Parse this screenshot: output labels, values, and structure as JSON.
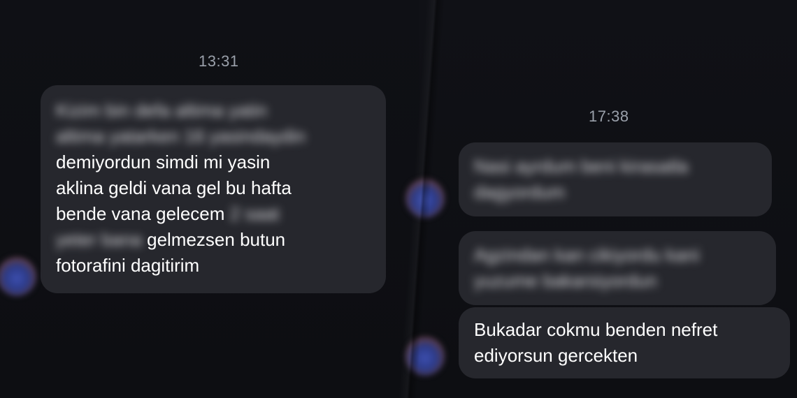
{
  "left_conversation": {
    "timestamp": "13:31",
    "message": {
      "blurred_line_1": "Kizim bin defa altima yatin",
      "blurred_line_2": "altima yatarken 16 yasindaydin",
      "line_3": "demiyordun simdi mi yasin",
      "line_4": "aklina geldi vana gel bu hafta",
      "line_5_visible": "bende vana gelecem",
      "line_5_blurred": "2 saat",
      "line_6_blurred": "yeter bana",
      "line_6_visible": "gelmezsen butun",
      "line_7": "fotorafini dagitirim"
    },
    "avatar_icon": "profile-avatar-icon"
  },
  "right_conversation": {
    "timestamp": "17:38",
    "messages": [
      {
        "blurred_line_1": "Nasi ayrdum beni kirasatla",
        "blurred_line_2": "dagyordum"
      },
      {
        "blurred_line_1": "Agzindan kan cikiyordu kani",
        "blurred_line_2": "yuzume bakarsiyordun"
      },
      {
        "line_1": "Bukadar cokmu benden nefret",
        "line_2": "ediyorsun gercekten"
      }
    ],
    "avatar_icon": "profile-avatar-icon"
  },
  "colors": {
    "background": "#0e0f14",
    "bubble": "#26272d",
    "timestamp": "#9aa0aa",
    "text": "#ffffff"
  }
}
